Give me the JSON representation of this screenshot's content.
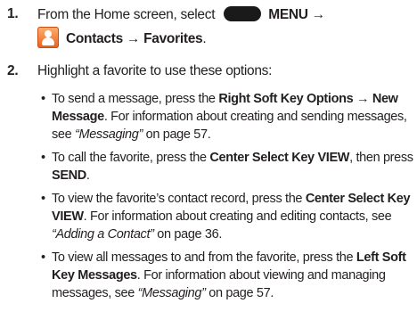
{
  "steps": [
    {
      "number": "1.",
      "line1_a": "From the Home screen, select",
      "menu_label": "MENU →",
      "contacts_path": "Contacts → Favorites",
      "contacts_end": "."
    },
    {
      "number": "2.",
      "text": "Highlight a favorite to use these options:"
    }
  ],
  "bullets": [
    {
      "t1": "To send a message, press the ",
      "b1": "Right Soft Key Options",
      "arrow": " → ",
      "b2": "New Message",
      "t2": ". For information about creating and sending messages, see ",
      "i1": "“Messaging”",
      "t3": " on page 57."
    },
    {
      "t1": "To call the favorite, press the ",
      "b1": "Center Select Key VIEW",
      "t2": ", then press ",
      "b2": "SEND",
      "t3": "."
    },
    {
      "t1": "To view the favorite’s contact record, press the ",
      "b1": "Center Select Key VIEW",
      "t2": ". For information about creating and editing contacts, see ",
      "i1": "“Adding a Contact”",
      "t3": " on page 36."
    },
    {
      "t1": "To view all messages to and from the favorite, press the ",
      "b1": "Left Soft Key Messages",
      "t2": ". For information about viewing and managing messages, see ",
      "i1": "“Messaging”",
      "t3": " on page 57."
    }
  ],
  "icons": {
    "menu_key": "menu-key-icon",
    "contacts": "contacts-icon"
  },
  "colors": {
    "text": "#231f20",
    "contacts_icon": "#e8601b"
  }
}
